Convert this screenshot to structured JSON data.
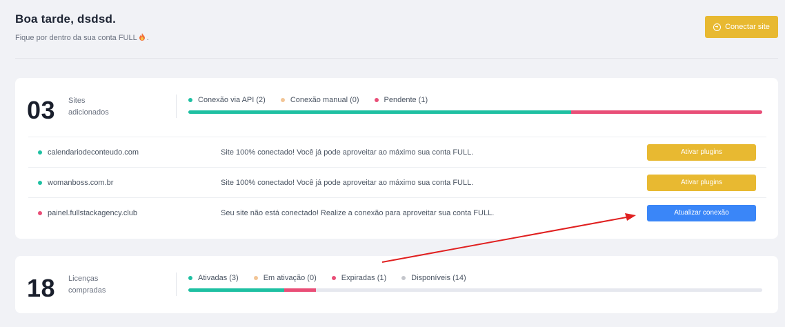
{
  "header": {
    "greeting": "Boa tarde, dsdsd.",
    "subtitle": "Fique por dentro da sua conta FULL",
    "subtitle_suffix": ".",
    "connect_button_label": "Conectar site"
  },
  "sites_card": {
    "count": "03",
    "label": "Sites adicionados",
    "legend": [
      {
        "label": "Conexão via API (2)",
        "color": "#1ec0a2"
      },
      {
        "label": "Conexão manual (0)",
        "color": "#f2c596"
      },
      {
        "label": "Pendente (1)",
        "color": "#e94e77"
      }
    ],
    "bar": [
      {
        "value": 2,
        "color": "#1ec0a2"
      },
      {
        "value": 0,
        "color": "#f2c596"
      },
      {
        "value": 1,
        "color": "#e94e77"
      }
    ],
    "bar_total": 3,
    "rows": [
      {
        "domain": "calendariodeconteudo.com",
        "status_color": "#1ec0a2",
        "message": "Site 100% conectado! Você já pode aproveitar ao máximo sua conta FULL.",
        "action_label": "Ativar plugins",
        "action_color": "#e8b931"
      },
      {
        "domain": "womanboss.com.br",
        "status_color": "#1ec0a2",
        "message": "Site 100% conectado! Você já pode aproveitar ao máximo sua conta FULL.",
        "action_label": "Ativar plugins",
        "action_color": "#e8b931"
      },
      {
        "domain": "painel.fullstackagency.club",
        "status_color": "#e94e77",
        "message": "Seu site não está conectado! Realize a conexão para aproveitar sua conta FULL.",
        "action_label": "Atualizar conexão",
        "action_color": "#3a86f8"
      }
    ]
  },
  "licenses_card": {
    "count": "18",
    "label": "Licenças compradas",
    "legend": [
      {
        "label": "Ativadas (3)",
        "color": "#1ec0a2"
      },
      {
        "label": "Em ativação (0)",
        "color": "#f2c596"
      },
      {
        "label": "Expiradas (1)",
        "color": "#e94e77"
      },
      {
        "label": "Disponíveis (14)",
        "color": "#c4c6cc"
      }
    ],
    "bar": [
      {
        "value": 3,
        "color": "#1ec0a2"
      },
      {
        "value": 0,
        "color": "#f2c596"
      },
      {
        "value": 1,
        "color": "#e94e77"
      },
      {
        "value": 14,
        "color": "#e6e8ef"
      }
    ],
    "bar_total": 18
  },
  "annotation_arrow_color": "#e02020"
}
